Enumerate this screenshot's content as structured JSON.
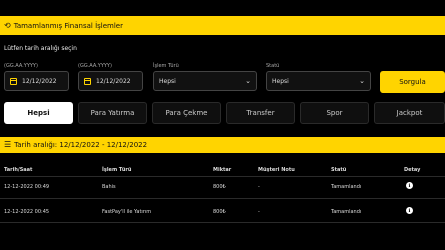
{
  "header": {
    "title": "Tamamlanmış Finansal İşlemler"
  },
  "hint": "Lütfen tarih aralığı seçin",
  "filters": {
    "start_label": "(GG.AA.YYYY)",
    "start_value": "12/12/2022",
    "end_label": "(GG.AA.YYYY)",
    "end_value": "12/12/2022",
    "type_label": "İşlem Türü",
    "type_value": "Hepsi",
    "status_label": "Statü",
    "status_value": "Hepsi",
    "query_button": "Sorgula"
  },
  "tabs": [
    {
      "label": "Hepsi",
      "active": true
    },
    {
      "label": "Para Yatırma"
    },
    {
      "label": "Para Çekme"
    },
    {
      "label": "Transfer"
    },
    {
      "label": "Spor"
    },
    {
      "label": "Jackpot"
    }
  ],
  "range": {
    "text": "Tarih aralığı: 12/12/2022 - 12/12/2022"
  },
  "table": {
    "headers": [
      "Tarih/Saat",
      "İşlem Türü",
      "Miktar",
      "Müşteri Notu",
      "Statü",
      "Detay"
    ],
    "rows": [
      [
        "12-12-2022 00:49",
        "Bahis",
        "800₺",
        "-",
        "Tamamlandı"
      ],
      [
        "12-12-2022 00:45",
        "FastPay'll ile Yatırım",
        "800₺",
        "-",
        "Tamamlandı"
      ]
    ]
  },
  "icons": {
    "header": "history-icon",
    "range": "list-icon",
    "date": "calendar-icon",
    "select": "chevron-down-icon",
    "detail": "info-icon"
  },
  "colors": {
    "accent": "#ffd400",
    "background": "#000000"
  }
}
